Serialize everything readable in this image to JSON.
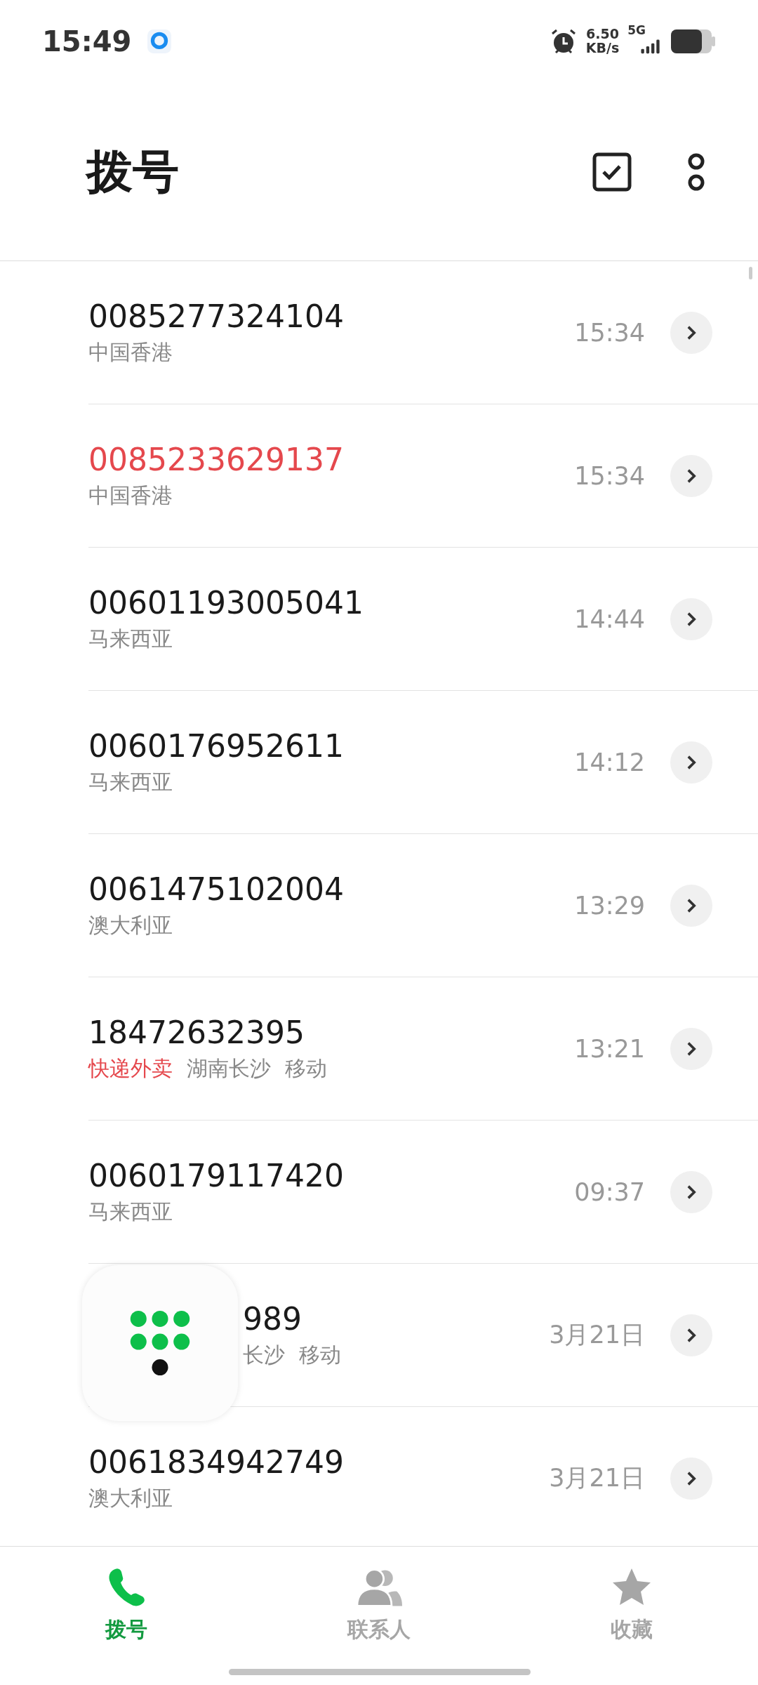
{
  "status_bar": {
    "time": "15:49",
    "speed_value": "6.50",
    "speed_unit": "KB/s",
    "network": "5G"
  },
  "header": {
    "title": "拨号"
  },
  "calls": [
    {
      "number": "0085277324104",
      "missed": false,
      "covered": false,
      "tags": [
        {
          "text": "中国香港",
          "flagged": false
        }
      ],
      "time": "15:34"
    },
    {
      "number": "0085233629137",
      "missed": true,
      "covered": false,
      "tags": [
        {
          "text": "中国香港",
          "flagged": false
        }
      ],
      "time": "15:34"
    },
    {
      "number": "00601193005041",
      "missed": false,
      "covered": false,
      "tags": [
        {
          "text": "马来西亚",
          "flagged": false
        }
      ],
      "time": "14:44"
    },
    {
      "number": "0060176952611",
      "missed": false,
      "covered": false,
      "tags": [
        {
          "text": "马来西亚",
          "flagged": false
        }
      ],
      "time": "14:12"
    },
    {
      "number": "0061475102004",
      "missed": false,
      "covered": false,
      "tags": [
        {
          "text": "澳大利亚",
          "flagged": false
        }
      ],
      "time": "13:29"
    },
    {
      "number": "18472632395",
      "missed": false,
      "covered": false,
      "tags": [
        {
          "text": "快递外卖",
          "flagged": true
        },
        {
          "text": "湖南长沙",
          "flagged": false
        },
        {
          "text": "移动",
          "flagged": false
        }
      ],
      "time": "13:21"
    },
    {
      "number": "0060179117420",
      "missed": false,
      "covered": false,
      "tags": [
        {
          "text": "马来西亚",
          "flagged": false
        }
      ],
      "time": "09:37"
    },
    {
      "number": "989",
      "missed": false,
      "covered": true,
      "tags": [
        {
          "text": "长沙",
          "flagged": false
        },
        {
          "text": "移动",
          "flagged": false
        }
      ],
      "time": "3月21日"
    },
    {
      "number": "0061834942749",
      "missed": false,
      "covered": false,
      "tags": [
        {
          "text": "澳大利亚",
          "flagged": false
        }
      ],
      "time": "3月21日"
    }
  ],
  "tabs": [
    {
      "label": "拨号",
      "kind": "phone",
      "selected": true
    },
    {
      "label": "联系人",
      "kind": "contacts",
      "selected": false
    },
    {
      "label": "收藏",
      "kind": "star",
      "selected": false
    }
  ]
}
